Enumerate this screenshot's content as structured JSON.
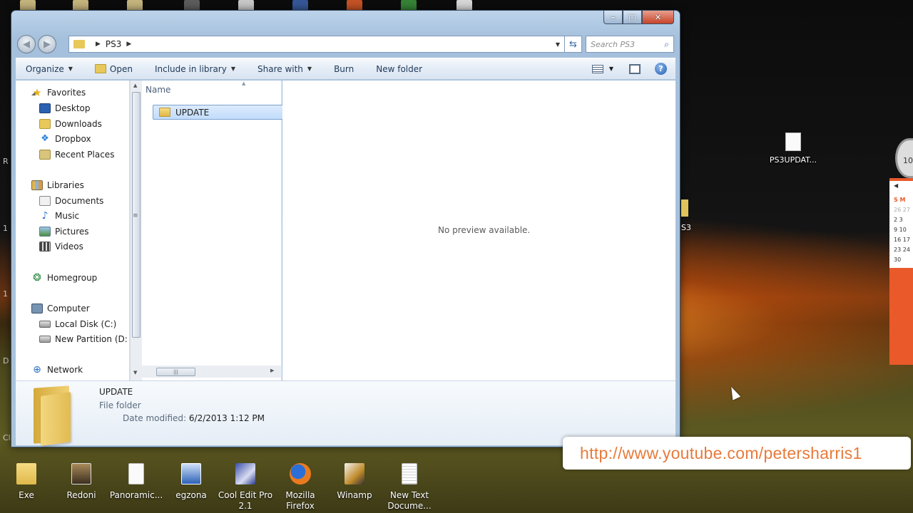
{
  "window": {
    "address": {
      "crumb": "PS3"
    },
    "search_placeholder": "Search PS3",
    "toolbar": {
      "organize": "Organize",
      "open": "Open",
      "include_in_library": "Include in library",
      "share_with": "Share with",
      "burn": "Burn",
      "new_folder": "New folder"
    },
    "navpane": {
      "favorites": "Favorites",
      "favorites_items": [
        "Desktop",
        "Downloads",
        "Dropbox",
        "Recent Places"
      ],
      "libraries": "Libraries",
      "libraries_items": [
        "Documents",
        "Music",
        "Pictures",
        "Videos"
      ],
      "homegroup": "Homegroup",
      "computer": "Computer",
      "computer_items": [
        "Local Disk (C:)",
        "New Partition (D:"
      ],
      "network": "Network"
    },
    "filelist": {
      "column_name": "Name",
      "items": [
        {
          "name": "UPDATE",
          "selected": true
        }
      ]
    },
    "preview_message": "No preview available.",
    "details": {
      "name": "UPDATE",
      "type": "File folder",
      "date_label": "Date modified:",
      "date_value": "6/2/2013 1:12 PM"
    }
  },
  "desktop": {
    "right_file": "PS3UPDAT...",
    "partial_label": "S3",
    "calendar": {
      "header": "S M",
      "rows": [
        "26 27",
        "2 3",
        "9 10",
        "16 17",
        "23 24",
        "30"
      ]
    },
    "clock_digit": "10",
    "url_banner": "http://www.youtube.com/petersharris1",
    "bottom_icons": [
      {
        "label": "Exe",
        "icon": "folder-icon"
      },
      {
        "label": "Redoni",
        "icon": "photo-icon"
      },
      {
        "label": "Panoramic...",
        "icon": "document-icon"
      },
      {
        "label": "egzona",
        "icon": "word-document-icon"
      },
      {
        "label": "Cool Edit Pro 2.1",
        "icon": "cool-edit-icon"
      },
      {
        "label": "Mozilla Firefox",
        "icon": "firefox-icon"
      },
      {
        "label": "Winamp",
        "icon": "winamp-icon"
      },
      {
        "label": "New Text Docume...",
        "icon": "text-document-icon"
      }
    ]
  },
  "colors": {
    "accent": "#1e3957",
    "selection": "#c1dcfc",
    "url_text": "#e87a3a"
  }
}
